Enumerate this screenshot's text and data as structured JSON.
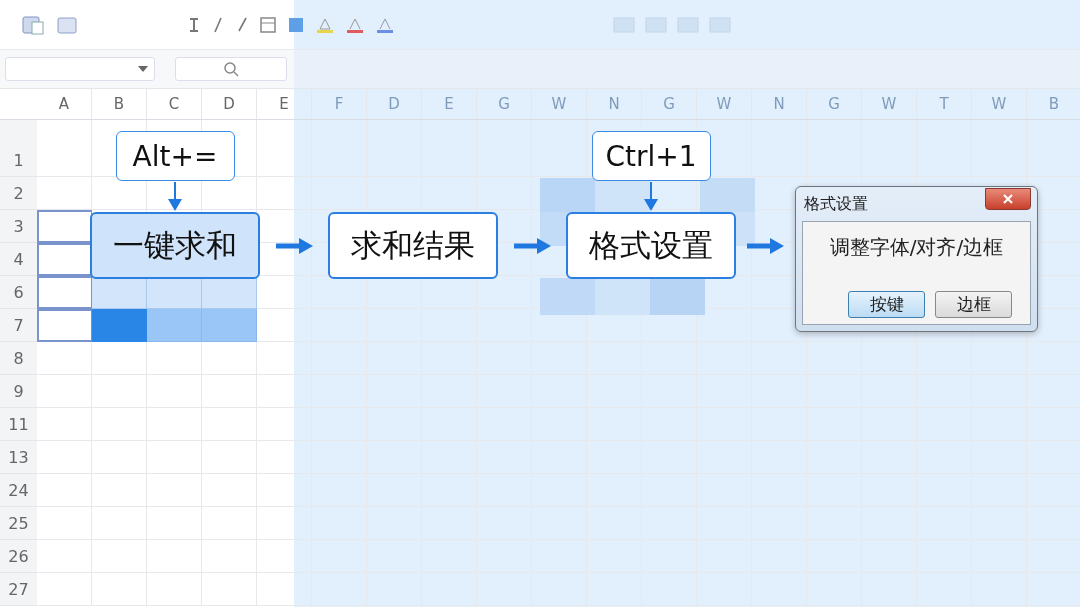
{
  "columns": [
    {
      "label": "A"
    },
    {
      "label": "B"
    },
    {
      "label": "C"
    },
    {
      "label": "D"
    },
    {
      "label": "E"
    },
    {
      "label": "F"
    },
    {
      "label": "D"
    },
    {
      "label": "E"
    },
    {
      "label": "G"
    },
    {
      "label": "W"
    },
    {
      "label": "N"
    },
    {
      "label": "G"
    },
    {
      "label": "W"
    },
    {
      "label": "N"
    },
    {
      "label": "G"
    },
    {
      "label": "W"
    },
    {
      "label": "T"
    },
    {
      "label": "W"
    },
    {
      "label": "B"
    }
  ],
  "rows": [
    {
      "label": "1"
    },
    {
      "label": "2"
    },
    {
      "label": "3",
      "cells": [
        {
          "kind": "outlined"
        }
      ]
    },
    {
      "label": "4",
      "cells": [
        {
          "kind": "outlined"
        }
      ]
    },
    {
      "label": "6",
      "cells": [
        {
          "kind": "outlined"
        },
        {
          "kind": "light"
        },
        {
          "kind": "light"
        },
        {
          "kind": "light"
        }
      ]
    },
    {
      "label": "7",
      "cells": [
        {
          "kind": "outlined"
        },
        {
          "kind": "dark"
        },
        {
          "kind": "medium"
        },
        {
          "kind": "medium"
        }
      ]
    },
    {
      "label": "8"
    },
    {
      "label": "9"
    },
    {
      "label": "11"
    },
    {
      "label": "13"
    },
    {
      "label": "24"
    },
    {
      "label": "25"
    },
    {
      "label": "26"
    },
    {
      "label": "27"
    }
  ],
  "flow": {
    "steps": [
      {
        "label": "一键求和",
        "highlighted": true,
        "shortcut": "Alt+="
      },
      {
        "label": "求和结果",
        "highlighted": false
      },
      {
        "label": "格式设置",
        "highlighted": false,
        "shortcut": "Ctrl+1"
      }
    ]
  },
  "dialog": {
    "title": "格式设置",
    "message": "调整字体/对齐/边框",
    "buttons": [
      {
        "label": "按键",
        "default": true
      },
      {
        "label": "边框",
        "default": false
      }
    ]
  }
}
